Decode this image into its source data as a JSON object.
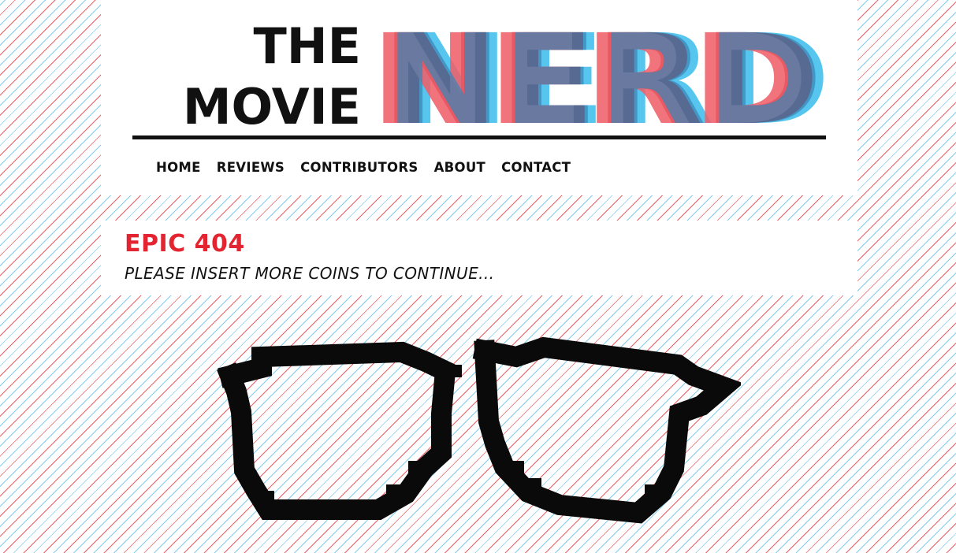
{
  "site": {
    "logo": {
      "line1": "THE",
      "line2": "MOVIE",
      "brand": "NERD",
      "colors": {
        "text": "#111111",
        "red": "#f0606a",
        "darkred": "#a8141e",
        "blue": "#3b86b8",
        "lightblue": "#4fc3ef"
      }
    },
    "nav": [
      {
        "label": "HOME"
      },
      {
        "label": "REVIEWS"
      },
      {
        "label": "CONTRIBUTORS"
      },
      {
        "label": "ABOUT"
      },
      {
        "label": "CONTACT"
      }
    ]
  },
  "error": {
    "title": "EPIC 404",
    "subtitle": "PLEASE INSERT MORE COINS TO CONTINUE...",
    "title_color": "#e22530"
  },
  "illustration": {
    "icon": "pixel-glasses-icon",
    "color": "#0a0a0a"
  }
}
